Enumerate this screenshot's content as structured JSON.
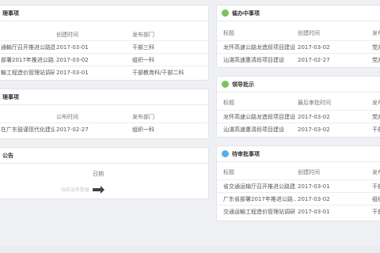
{
  "panels": {
    "p1": {
      "title": "理事项",
      "columns": [
        "创建时间",
        "发布部门"
      ],
      "rows": [
        [
          "通輸厅召开推进公路建...",
          "2017-03-01",
          "干部三科"
        ],
        [
          "部署2017年推进公路...",
          "2017-03-02",
          "组织一科"
        ],
        [
          "輸工程造价管理站调研",
          "2017-03-01",
          "干部教育科/干部二科"
        ]
      ]
    },
    "p2": {
      "title": "理事项",
      "columns": [
        "公布时间",
        "发布部门"
      ],
      "rows": [
        [
          "在广东鼓谨现代化建设...",
          "2017-02-27",
          "组织一科"
        ]
      ]
    },
    "p3": {
      "title": "公告",
      "column": "日期",
      "empty_text": "当前没有数据"
    },
    "p4": {
      "title": "催办中事项",
      "columns": [
        "标题",
        "创建时间",
        "发布"
      ],
      "rows": [
        [
          "龙怀高速公路龙造段项目建设",
          "2017-03-02",
          "党办"
        ],
        [
          "汕湛高速惠清段项目建设",
          "2017-02-27",
          "党办"
        ]
      ]
    },
    "p5": {
      "title": "领导批示",
      "columns": [
        "标题",
        "最后审批时间",
        "发布"
      ],
      "rows": [
        [
          "龙怀高速公路龙造段项目建设",
          "2017-03-02",
          "党办"
        ],
        [
          "汕湛高速惠清段项目建设",
          "2017-03-02",
          "干部"
        ]
      ]
    },
    "p6": {
      "title": "待审批事项",
      "columns": [
        "标题",
        "创建时间",
        "发布"
      ],
      "rows": [
        [
          "省交通运输厅召开推进公路建...",
          "2017-03-01",
          "干部"
        ],
        [
          "广东省部署2017年推进公路...",
          "2017-03-02",
          "组织"
        ],
        [
          "交通运輸工程造价管理站调研",
          "2017-03-01",
          "干部"
        ]
      ]
    }
  },
  "colors": {
    "accent_green": "#7cc15a",
    "accent_blue": "#58aee8"
  },
  "icons": {
    "p4": "green-dot-icon",
    "p5": "green-dot-icon",
    "p6": "blue-dot-icon"
  }
}
